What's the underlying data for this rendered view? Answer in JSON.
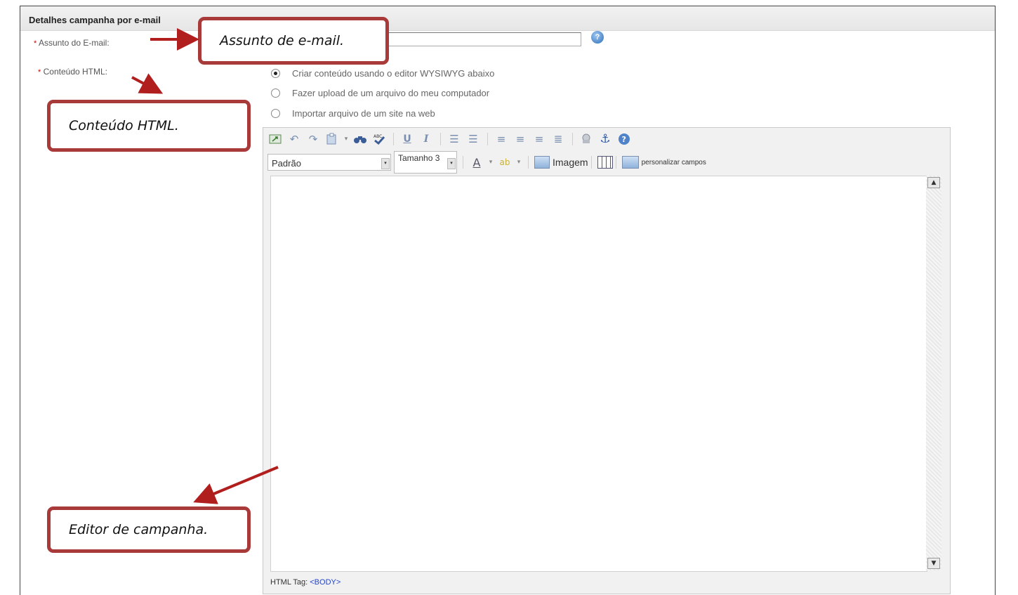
{
  "header": {
    "title": "Detalhes campanha por e-mail"
  },
  "subject": {
    "required_mark": "*",
    "label": "Assunto do E-mail:",
    "value": "",
    "help_glyph": "?"
  },
  "html_content": {
    "required_mark": "*",
    "label": "Conteúdo HTML:",
    "options": [
      {
        "label": "Criar conteúdo usando o editor WYSIWYG abaixo",
        "selected": true
      },
      {
        "label": "Fazer upload de um arquivo do meu computador",
        "selected": false
      },
      {
        "label": "Importar arquivo de um site na web",
        "selected": false
      }
    ]
  },
  "editor": {
    "toolbar1_icons": [
      "source-icon",
      "undo-icon",
      "redo-icon",
      "paste-icon",
      "find-icon",
      "spellcheck-icon",
      "underline-icon",
      "italic-icon",
      "ordered-list-icon",
      "unordered-list-icon",
      "align-left-icon",
      "align-center-icon",
      "align-right-icon",
      "justify-icon",
      "link-icon",
      "anchor-icon",
      "help-icon"
    ],
    "font_select": "Padrão",
    "size_select": "Tamanho 3",
    "image_button": "Imagem",
    "personalize_button": "personalizar campos",
    "status_label": "HTML Tag:",
    "status_tag": "<BODY>"
  },
  "callouts": {
    "subject": "Assunto de e-mail.",
    "html": "Conteúdo HTML.",
    "editor": "Editor de campanha."
  },
  "colors": {
    "callout_border": "#a93a3a",
    "arrow": "#b01e1e",
    "required": "#cc0000"
  }
}
